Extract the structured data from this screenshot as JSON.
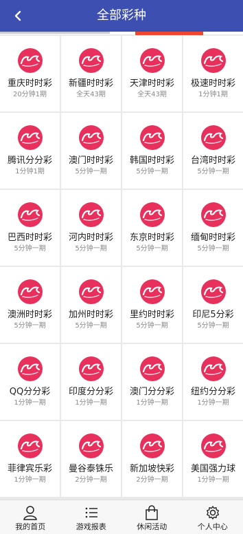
{
  "header": {
    "title": "全部彩种",
    "back_icon": "chevron-left-icon"
  },
  "colors": {
    "header_bg": "#3d4fb1",
    "logo_bg": "#e7305c",
    "tab_active": "#f0462f"
  },
  "games": [
    {
      "name": "重庆时时彩",
      "period": "20分钟1期"
    },
    {
      "name": "新疆时时彩",
      "period": "全天43期"
    },
    {
      "name": "天津时时彩",
      "period": "全天43期"
    },
    {
      "name": "极速时时彩",
      "period": "1分钟1期"
    },
    {
      "name": "腾讯分分彩",
      "period": "1分钟1期"
    },
    {
      "name": "澳门时时彩",
      "period": "5分钟一期"
    },
    {
      "name": "韩国时时彩",
      "period": "5分钟一期"
    },
    {
      "name": "台湾时时彩",
      "period": "5分钟一期"
    },
    {
      "name": "巴西时时彩",
      "period": "5分钟一期"
    },
    {
      "name": "河内时时彩",
      "period": "5分钟一期"
    },
    {
      "name": "东京时时彩",
      "period": "5分钟一期"
    },
    {
      "name": "缅甸时时彩",
      "period": "5分钟一期"
    },
    {
      "name": "澳洲时时彩",
      "period": "5分钟一期"
    },
    {
      "name": "加州时时彩",
      "period": "5分钟一期"
    },
    {
      "name": "里约时时彩",
      "period": "5分钟一期"
    },
    {
      "name": "印尼5分彩",
      "period": "5分钟一期"
    },
    {
      "name": "QQ分分彩",
      "period": "1分钟一期"
    },
    {
      "name": "印度分分彩",
      "period": "1分钟一期"
    },
    {
      "name": "澳门分分彩",
      "period": "1分钟一期"
    },
    {
      "name": "纽约分分彩",
      "period": "1分钟一期"
    },
    {
      "name": "菲律宾乐彩",
      "period": "1分钟一期"
    },
    {
      "name": "曼谷泰铢乐",
      "period": "2分钟一期"
    },
    {
      "name": "新加坡快彩",
      "period": "2分钟一期"
    },
    {
      "name": "美国强力球",
      "period": "1分钟一期"
    }
  ],
  "footer": {
    "tabs": [
      {
        "label": "我的首页",
        "icon": "user-icon"
      },
      {
        "label": "游戏报表",
        "icon": "list-icon"
      },
      {
        "label": "休闲活动",
        "icon": "bag-icon"
      },
      {
        "label": "个人中心",
        "icon": "gear-icon"
      }
    ]
  }
}
